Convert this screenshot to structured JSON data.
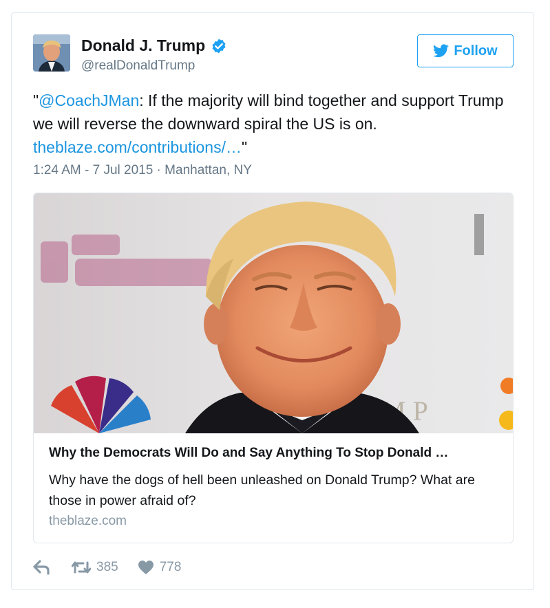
{
  "user": {
    "name": "Donald J. Trump",
    "handle": "@realDonaldTrump",
    "follow_label": "Follow"
  },
  "tweet": {
    "quote_open": "\"",
    "mention": "@CoachJMan",
    "text": ": If the majority will bind together and support Trump we will reverse the downward spiral the US is on. ",
    "link": "theblaze.com/contributions/…",
    "quote_close": "\"",
    "timestamp": "1:24 AM - 7 Jul 2015",
    "separator": " · ",
    "location": "Manhattan, NY"
  },
  "card": {
    "title": "Why the Democrats Will Do and Say Anything To Stop Donald …",
    "description": "Why have the dogs of hell been unleashed on Donald Trump? What are those in power afraid of?",
    "domain": "theblaze.com"
  },
  "actions": {
    "retweets": "385",
    "likes": "778"
  },
  "colors": {
    "accent": "#1da1f2",
    "link": "#1b95e0",
    "muted": "#657786",
    "action_gray": "#8899a6",
    "border": "#e1e8ed"
  },
  "icons": [
    "verified-badge-icon",
    "twitter-bird-icon",
    "reply-icon",
    "retweet-icon",
    "heart-icon"
  ]
}
